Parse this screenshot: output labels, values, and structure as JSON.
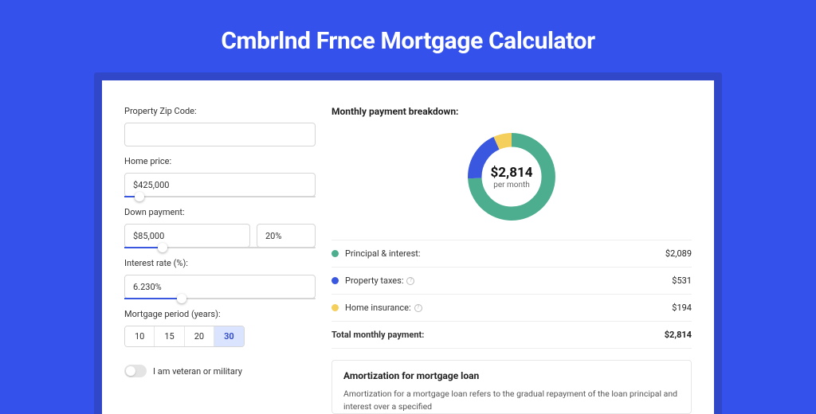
{
  "headline": "Cmbrlnd Frnce Mortgage Calculator",
  "left": {
    "zip_label": "Property Zip Code:",
    "zip_value": "",
    "home_price_label": "Home price:",
    "home_price_value": "$425,000",
    "home_price_slider_pct": 8,
    "down_label": "Down payment:",
    "down_value": "$85,000",
    "down_pct_value": "20%",
    "down_slider_pct": 20,
    "rate_label": "Interest rate (%):",
    "rate_value": "6.230%",
    "rate_slider_pct": 30,
    "period_label": "Mortgage period (years):",
    "periods": [
      {
        "label": "10",
        "active": false
      },
      {
        "label": "15",
        "active": false
      },
      {
        "label": "20",
        "active": false
      },
      {
        "label": "30",
        "active": true
      }
    ],
    "veteran_label": "I am veteran or military"
  },
  "right": {
    "breakdown_title": "Monthly payment breakdown:",
    "donut_value": "$2,814",
    "donut_sub": "per month",
    "rows": [
      {
        "color": "#4cae8e",
        "label": "Principal & interest:",
        "amount": "$2,089",
        "info": false
      },
      {
        "color": "#3958df",
        "label": "Property taxes:",
        "amount": "$531",
        "info": true
      },
      {
        "color": "#f4cf5b",
        "label": "Home insurance:",
        "amount": "$194",
        "info": true
      }
    ],
    "total_label": "Total monthly payment:",
    "total_amount": "$2,814",
    "amort_title": "Amortization for mortgage loan",
    "amort_text": "Amortization for a mortgage loan refers to the gradual repayment of the loan principal and interest over a specified"
  },
  "chart_data": {
    "type": "pie",
    "title": "Monthly payment breakdown",
    "series": [
      {
        "name": "Principal & interest",
        "value": 2089,
        "color": "#4cae8e"
      },
      {
        "name": "Property taxes",
        "value": 531,
        "color": "#3958df"
      },
      {
        "name": "Home insurance",
        "value": 194,
        "color": "#f4cf5b"
      }
    ],
    "total": 2814,
    "center_label": "$2,814 per month"
  }
}
